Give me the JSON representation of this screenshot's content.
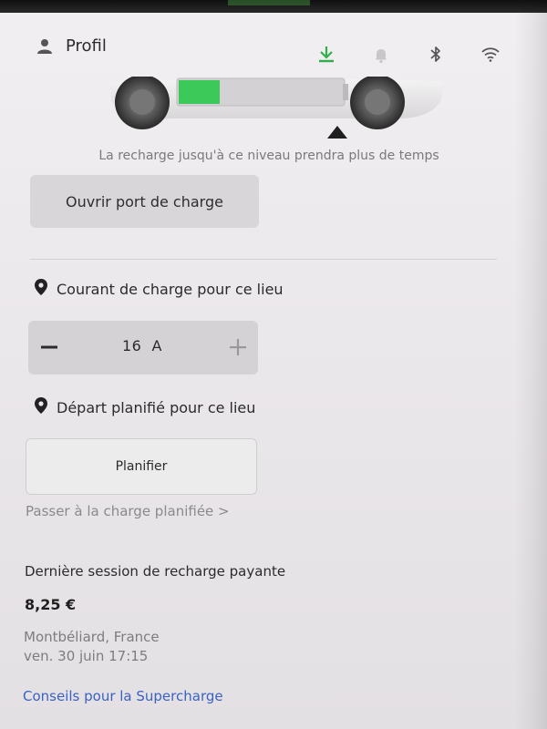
{
  "header": {
    "profile_label": "Profil",
    "icons": [
      "person-icon",
      "download-icon",
      "bell-icon",
      "bluetooth-icon",
      "wifi-icon"
    ],
    "accent_color": "#2fae4a"
  },
  "charge": {
    "range_note": "La recharge jusqu'à ce niveau prendra plus de temps",
    "battery_level_fraction": 0.25,
    "open_port_label": "Ouvrir port de charge"
  },
  "current": {
    "title": "Courant de charge pour ce lieu",
    "value": "16  A"
  },
  "departure": {
    "title": "Départ planifié pour ce lieu",
    "schedule_label": "Planifier",
    "switch_link": "Passer à la charge planifiée >"
  },
  "last_session": {
    "title": "Dernière session de recharge payante",
    "amount": "8,25 €",
    "location": "Montbéliard, France",
    "datetime": "ven. 30 juin 17:15"
  },
  "supercharge_link": "Conseils pour la Supercharge",
  "colors": {
    "link_blue": "#3a62c4",
    "battery_green": "#3cc95a"
  }
}
